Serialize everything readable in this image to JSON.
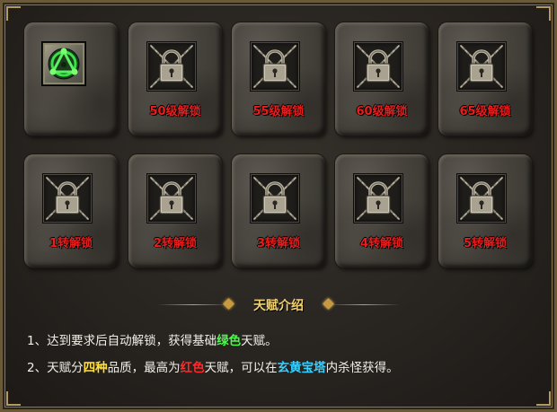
{
  "slots_row1": [
    {
      "type": "talent",
      "icon": "triangle-circle-talent-icon",
      "label": ""
    },
    {
      "type": "locked",
      "icon": "padlock-chains-icon",
      "label": "50级解锁"
    },
    {
      "type": "locked",
      "icon": "padlock-chains-icon",
      "label": "55级解锁"
    },
    {
      "type": "locked",
      "icon": "padlock-chains-icon",
      "label": "60级解锁"
    },
    {
      "type": "locked",
      "icon": "padlock-chains-icon",
      "label": "65级解锁"
    }
  ],
  "slots_row2": [
    {
      "type": "locked",
      "icon": "padlock-chains-icon",
      "label": "1转解锁"
    },
    {
      "type": "locked",
      "icon": "padlock-chains-icon",
      "label": "2转解锁"
    },
    {
      "type": "locked",
      "icon": "padlock-chains-icon",
      "label": "3转解锁"
    },
    {
      "type": "locked",
      "icon": "padlock-chains-icon",
      "label": "4转解锁"
    },
    {
      "type": "locked",
      "icon": "padlock-chains-icon",
      "label": "5转解锁"
    }
  ],
  "intro": {
    "title": "天赋介绍",
    "line1": {
      "a": "1、达到要求后自动解锁，获得基础",
      "b": "绿色",
      "c": "天赋。"
    },
    "line2": {
      "a": "2、天赋分",
      "b": "四种",
      "c": "品质，最高为",
      "d": "红色",
      "e": "天赋，可以在",
      "f": "玄黄宝塔",
      "g": "内杀怪获得。"
    }
  },
  "colors": {
    "unlock_label": "#e81e1e",
    "title": "#f0d070",
    "green": "#4ef84e",
    "yellow": "#ffe040",
    "red": "#ff2a2a",
    "cyan": "#3ad0ff"
  }
}
